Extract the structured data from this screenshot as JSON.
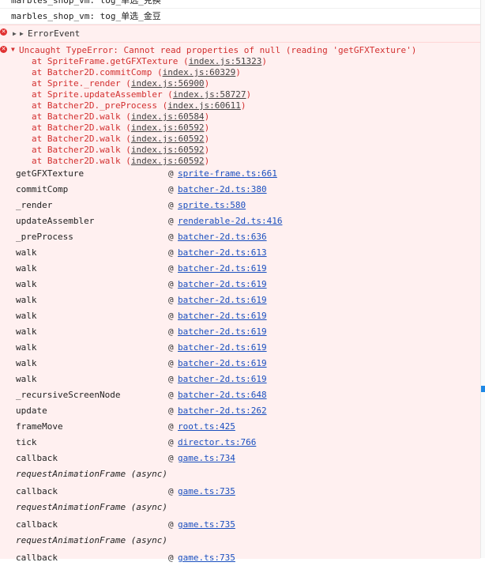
{
  "logs": [
    {
      "text": "marbles_shop_vm: tog_单选_兑换"
    },
    {
      "text": "marbles_shop_vm: tog_单选_金豆"
    }
  ],
  "error_event": {
    "label": "ErrorEvent",
    "icon": "error-icon"
  },
  "uncaught": {
    "message": "Uncaught TypeError: Cannot read properties of null (reading 'getGFXTexture')",
    "stack": [
      {
        "pre": "at SpriteFrame.getGFXTexture (",
        "link": "index.js:51323",
        "post": ")"
      },
      {
        "pre": "at Batcher2D.commitComp (",
        "link": "index.js:60329",
        "post": ")"
      },
      {
        "pre": "at Sprite._render (",
        "link": "index.js:56900",
        "post": ")"
      },
      {
        "pre": "at Sprite.updateAssembler (",
        "link": "index.js:58727",
        "post": ")"
      },
      {
        "pre": "at Batcher2D._preProcess (",
        "link": "index.js:60611",
        "post": ")"
      },
      {
        "pre": "at Batcher2D.walk (",
        "link": "index.js:60584",
        "post": ")"
      },
      {
        "pre": "at Batcher2D.walk (",
        "link": "index.js:60592",
        "post": ")"
      },
      {
        "pre": "at Batcher2D.walk (",
        "link": "index.js:60592",
        "post": ")"
      },
      {
        "pre": "at Batcher2D.walk (",
        "link": "index.js:60592",
        "post": ")"
      },
      {
        "pre": "at Batcher2D.walk (",
        "link": "index.js:60592",
        "post": ")"
      }
    ]
  },
  "frames": [
    {
      "fn": "getGFXTexture",
      "at": "@",
      "src": "sprite-frame.ts:661"
    },
    {
      "fn": "commitComp",
      "at": "@",
      "src": "batcher-2d.ts:380"
    },
    {
      "fn": "_render",
      "at": "@",
      "src": "sprite.ts:580"
    },
    {
      "fn": "updateAssembler",
      "at": "@",
      "src": "renderable-2d.ts:416"
    },
    {
      "fn": "_preProcess",
      "at": "@",
      "src": "batcher-2d.ts:636"
    },
    {
      "fn": "walk",
      "at": "@",
      "src": "batcher-2d.ts:613"
    },
    {
      "fn": "walk",
      "at": "@",
      "src": "batcher-2d.ts:619"
    },
    {
      "fn": "walk",
      "at": "@",
      "src": "batcher-2d.ts:619"
    },
    {
      "fn": "walk",
      "at": "@",
      "src": "batcher-2d.ts:619"
    },
    {
      "fn": "walk",
      "at": "@",
      "src": "batcher-2d.ts:619"
    },
    {
      "fn": "walk",
      "at": "@",
      "src": "batcher-2d.ts:619"
    },
    {
      "fn": "walk",
      "at": "@",
      "src": "batcher-2d.ts:619"
    },
    {
      "fn": "walk",
      "at": "@",
      "src": "batcher-2d.ts:619"
    },
    {
      "fn": "walk",
      "at": "@",
      "src": "batcher-2d.ts:619"
    },
    {
      "fn": "_recursiveScreenNode",
      "at": "@",
      "src": "batcher-2d.ts:648"
    },
    {
      "fn": "update",
      "at": "@",
      "src": "batcher-2d.ts:262"
    },
    {
      "fn": "frameMove",
      "at": "@",
      "src": "root.ts:425"
    },
    {
      "fn": "tick",
      "at": "@",
      "src": "director.ts:766"
    },
    {
      "fn": "callback",
      "at": "@",
      "src": "game.ts:734"
    },
    {
      "fn": "requestAnimationFrame (async)",
      "async": true
    },
    {
      "fn": "callback",
      "at": "@",
      "src": "game.ts:735"
    },
    {
      "fn": "requestAnimationFrame (async)",
      "async": true
    },
    {
      "fn": "callback",
      "at": "@",
      "src": "game.ts:735"
    },
    {
      "fn": "requestAnimationFrame (async)",
      "async": true
    },
    {
      "fn": "callback",
      "at": "@",
      "src": "game.ts:735"
    }
  ],
  "colors": {
    "error_text": "#d32f2f",
    "error_bg": "#fff0f0",
    "link": "#1a4fbf",
    "scroll_thumb": "#1e88e5"
  }
}
